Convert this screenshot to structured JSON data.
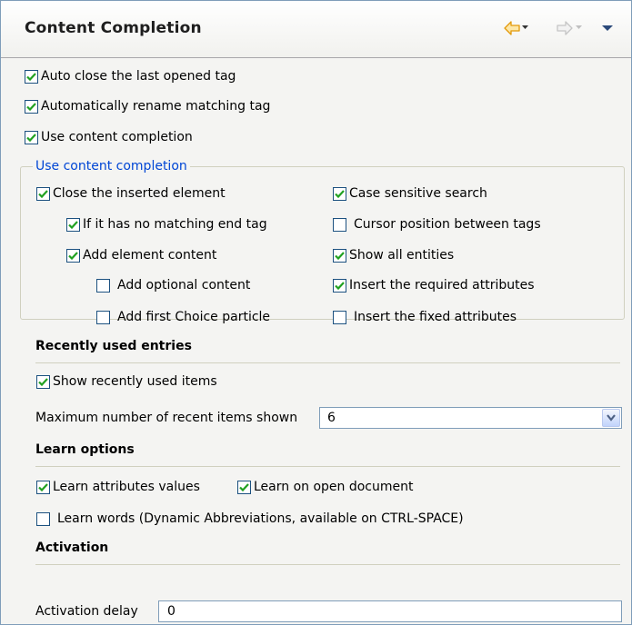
{
  "header": {
    "title": "Content Completion",
    "icons": [
      "back-arrow-icon",
      "dropdown-icon",
      "forward-arrow-icon",
      "view-menu-icon"
    ]
  },
  "top_options": [
    {
      "label": "Auto close the last opened tag",
      "checked": true
    },
    {
      "label": "Automatically rename matching tag",
      "checked": true
    },
    {
      "label": "Use content completion",
      "checked": true
    }
  ],
  "group": {
    "legend": "Use content completion",
    "left_options": [
      {
        "label": "Close the inserted element",
        "checked": true
      },
      {
        "label": "If it has no matching end tag",
        "checked": true
      },
      {
        "label": "Add element content",
        "checked": true
      },
      {
        "label": "Add optional content",
        "checked": false
      },
      {
        "label": "Add first Choice particle",
        "checked": false
      }
    ],
    "right_options": [
      {
        "label": "Case sensitive search",
        "checked": true
      },
      {
        "label": "Cursor position between tags",
        "checked": false
      },
      {
        "label": "Show all entities",
        "checked": true
      },
      {
        "label": "Insert the required attributes",
        "checked": true
      },
      {
        "label": "Insert the fixed attributes",
        "checked": false
      }
    ]
  },
  "recent": {
    "title": "Recently used entries",
    "show": {
      "label": "Show recently used items",
      "checked": true
    },
    "max_label": "Maximum number of recent items shown",
    "max_value": "6"
  },
  "learn": {
    "title": "Learn options",
    "attributes": {
      "label": "Learn attributes values",
      "checked": true
    },
    "open_doc": {
      "label": "Learn on open document",
      "checked": true
    },
    "words": {
      "label": "Learn words (Dynamic Abbreviations, available on CTRL-SPACE)",
      "checked": false
    }
  },
  "activation": {
    "title": "Activation",
    "delay_label": "Activation delay",
    "delay_value": "0"
  },
  "colors": {
    "legend": "#0046d5",
    "check": "#21a121",
    "checkbox_border": "#1c5180",
    "back_arrow": "#f0a20c"
  }
}
